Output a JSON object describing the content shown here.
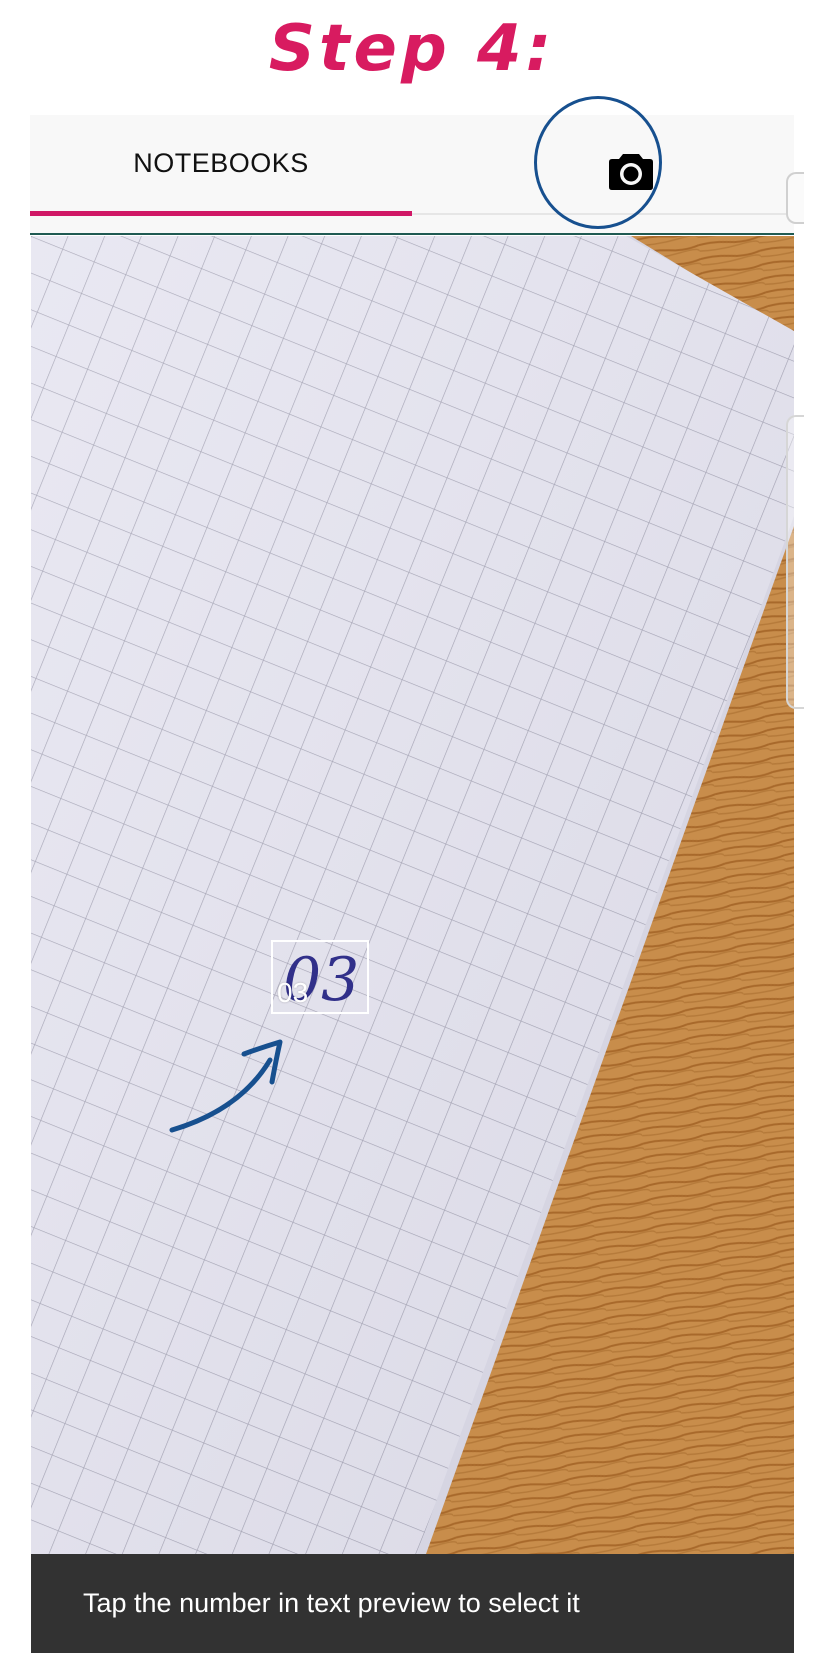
{
  "tutorial": {
    "step_label": "Step 4:",
    "accent_color": "#d81b60",
    "highlight_color": "#17508f"
  },
  "tabs": {
    "notebooks_label": "NOTEBOOKS",
    "camera_icon": "camera-icon",
    "indicator_color": "#d01866"
  },
  "preview": {
    "detected_text": "03",
    "handwritten_text": "03"
  },
  "snackbar": {
    "message": "Tap the number in text preview to select it"
  }
}
